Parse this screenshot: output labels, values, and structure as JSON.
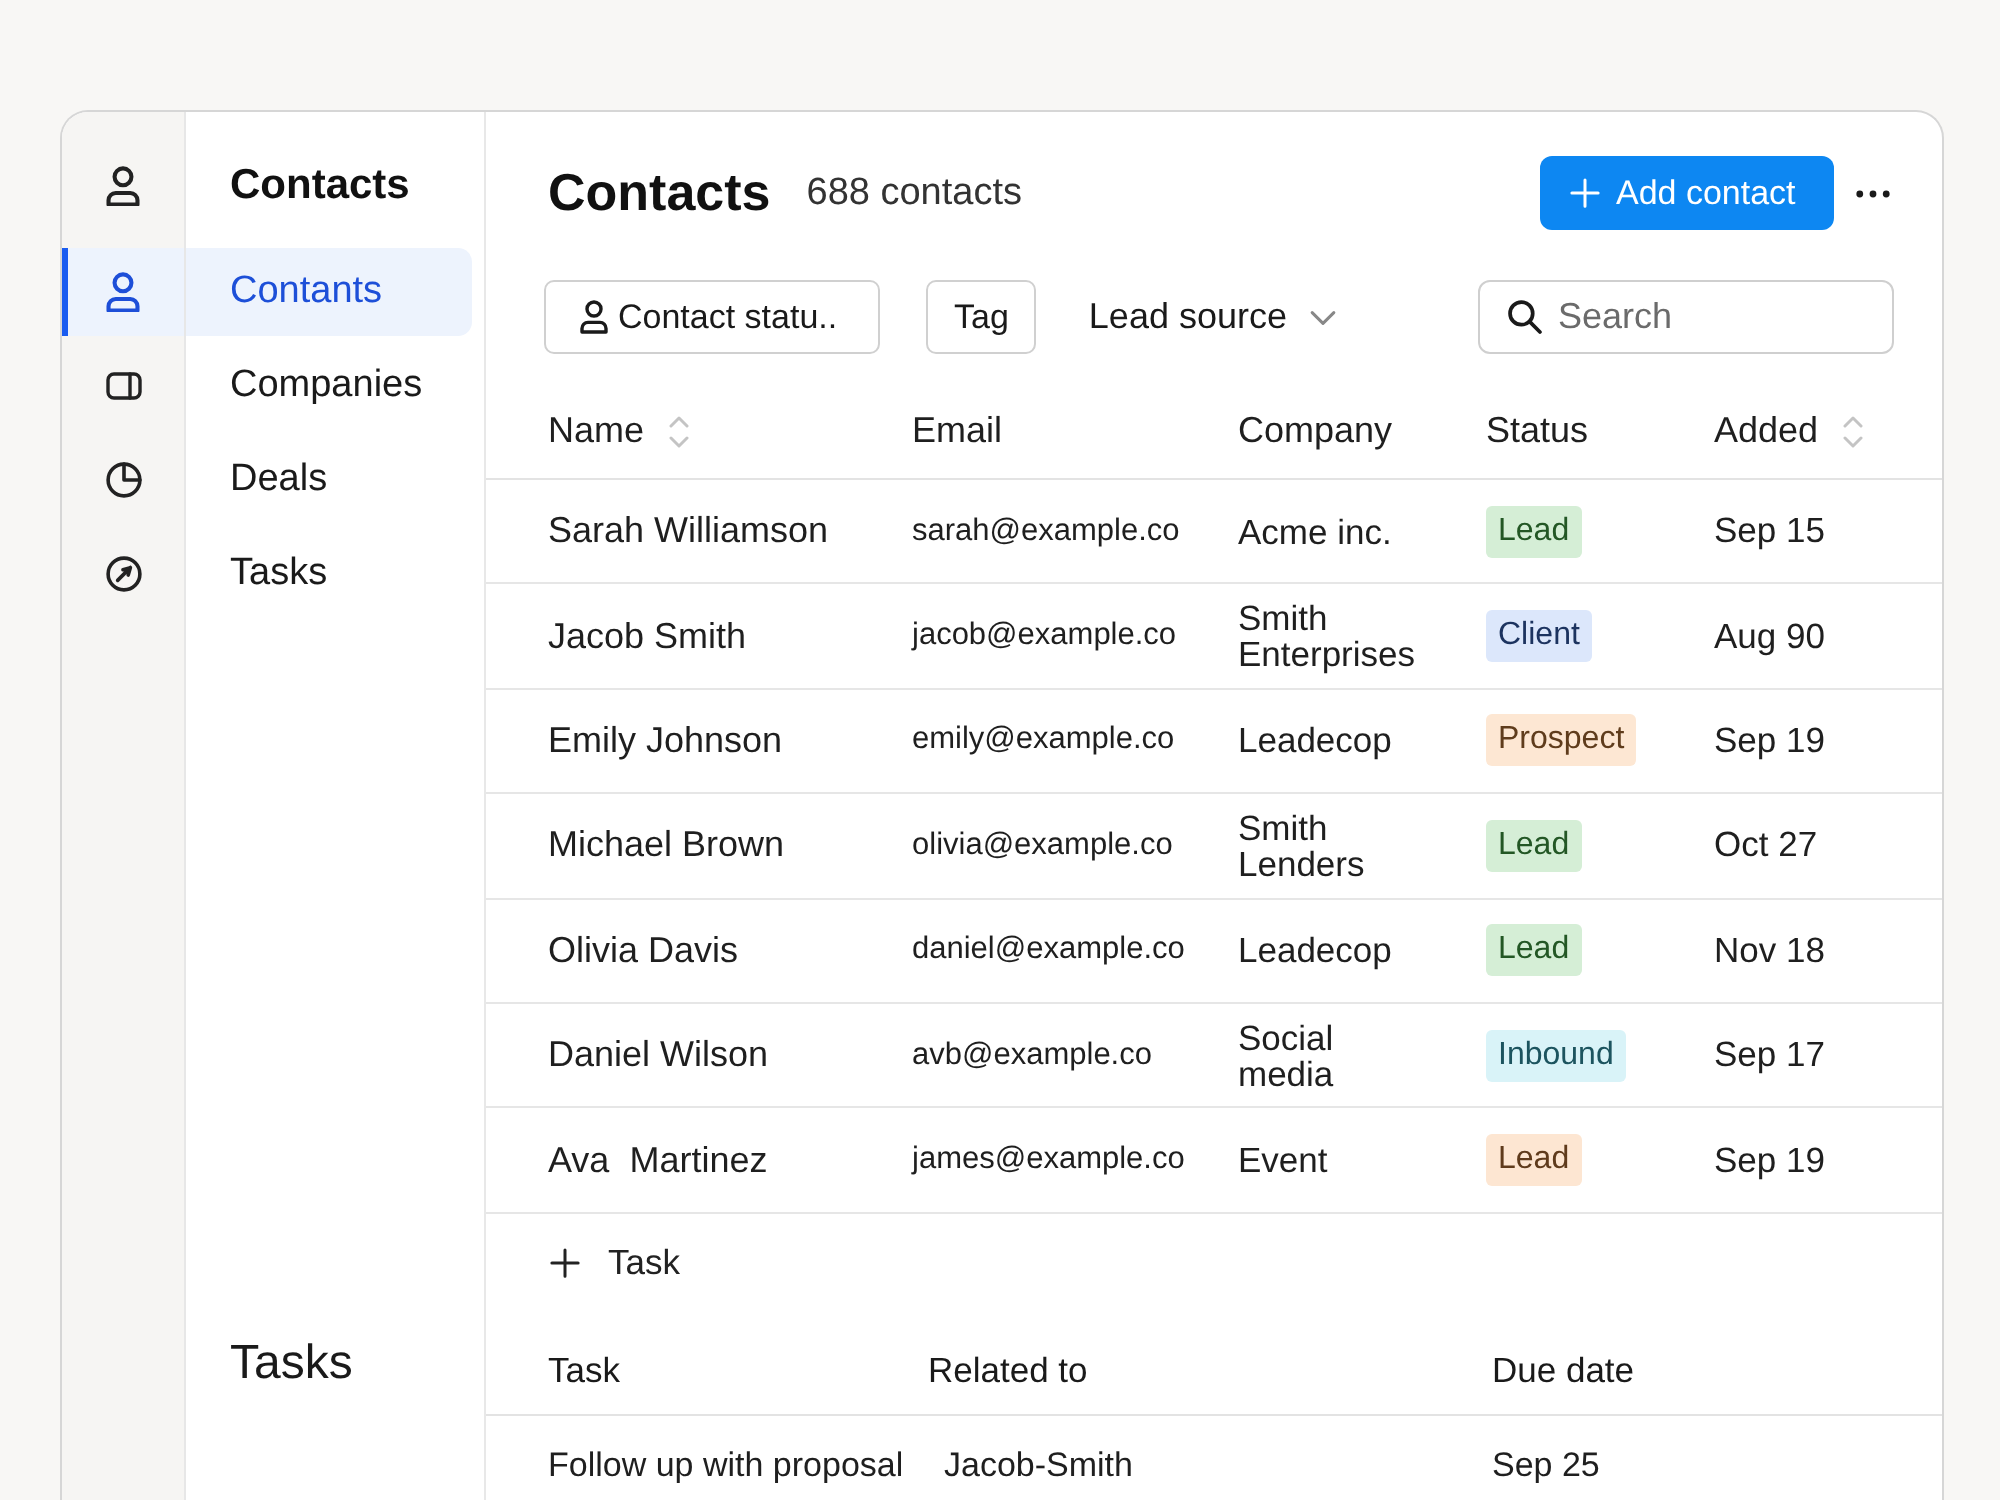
{
  "sidebar": {
    "title": "Contacts",
    "items": [
      {
        "label": "Contants",
        "selected": true
      },
      {
        "label": "Companies",
        "selected": false
      },
      {
        "label": "Deals",
        "selected": false
      },
      {
        "label": "Tasks",
        "selected": false
      }
    ],
    "section_heading": "Tasks"
  },
  "header": {
    "title": "Contacts",
    "count": "688 contacts",
    "add_button": "Add contact"
  },
  "filters": {
    "contact_status": "Contact statu..",
    "tag": "Tag",
    "lead_source": "Lead source",
    "search": {
      "placeholder": "Search"
    }
  },
  "contacts_table": {
    "columns": [
      {
        "label": "Name",
        "sortable": true
      },
      {
        "label": "Email",
        "sortable": false
      },
      {
        "label": "Company",
        "sortable": false
      },
      {
        "label": "Status",
        "sortable": false
      },
      {
        "label": "Added",
        "sortable": true
      }
    ],
    "rows": [
      {
        "name": "Sarah Williamson",
        "email": "sarah@example.co",
        "company": "Acme inc.",
        "status": {
          "label": "Lead",
          "color": "#d5eed6"
        },
        "added": "Sep 15"
      },
      {
        "name": "Jacob Smith",
        "email": "jacob@example.co",
        "company": "Smith Enterprises",
        "status": {
          "label": "Client",
          "color": "#dce7fb"
        },
        "added": "Aug 90"
      },
      {
        "name": "Emily Johnson",
        "email": "emily@example.co",
        "company": "Leadecop",
        "status": {
          "label": "Prospect",
          "color": "#fde7d3"
        },
        "added": "Sep 19"
      },
      {
        "name": "Michael Brown",
        "email": "olivia@example.co",
        "company": "Smith Lenders",
        "status": {
          "label": "Lead",
          "color": "#d5eed6"
        },
        "added": "Oct 27"
      },
      {
        "name": "Olivia Davis",
        "email": "daniel@example.co",
        "company": "Leadecop",
        "status": {
          "label": "Lead",
          "color": "#d5eed6"
        },
        "added": "Nov 18"
      },
      {
        "name": "Daniel Wilson",
        "email": "avb@example.co",
        "company": "Social media",
        "status": {
          "label": "Inbound",
          "color": "#d9f3f8"
        },
        "added": "Sep 17"
      },
      {
        "name": "Ava  Martinez",
        "email": "james@example.co",
        "company": "Event",
        "status": {
          "label": "Lead",
          "color": "#fde6d2"
        },
        "added": "Sep 19"
      }
    ]
  },
  "add_task": "Task",
  "tasks_table": {
    "columns": [
      "Task",
      "Related to",
      "Due date"
    ],
    "rows": [
      {
        "task": "Follow up with proposal",
        "related_to": "Jacob-Smith",
        "due_date": "Sep 25"
      }
    ]
  }
}
